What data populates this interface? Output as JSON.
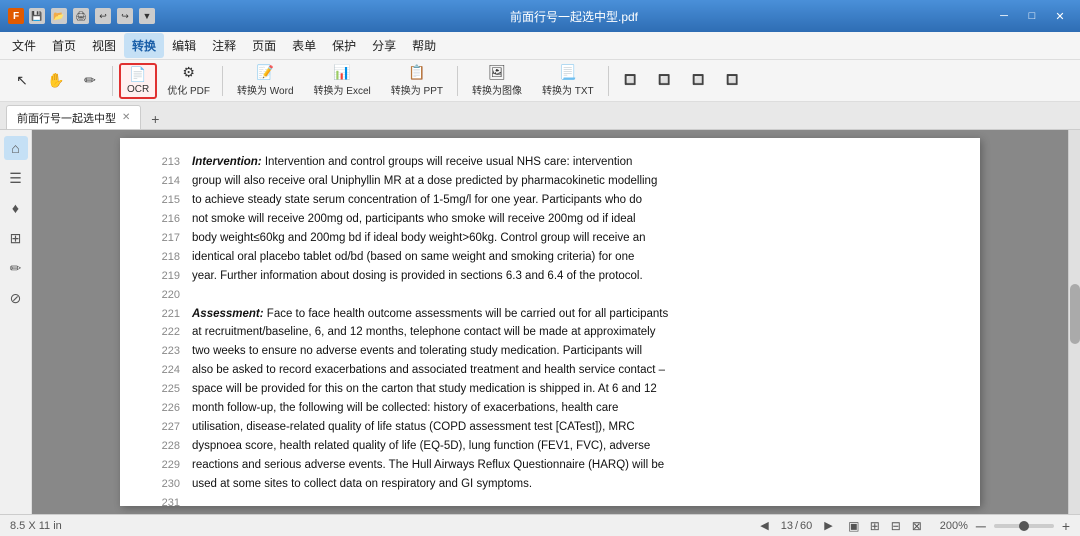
{
  "titlebar": {
    "title": "前面行号一起选中型.pdf",
    "app_icon": "F",
    "minimize": "─",
    "maximize": "□",
    "close": "✕"
  },
  "menubar": {
    "items": [
      {
        "label": "文件",
        "active": false
      },
      {
        "label": "首页",
        "active": false
      },
      {
        "label": "视图",
        "active": false
      },
      {
        "label": "转换",
        "active": true
      },
      {
        "label": "编辑",
        "active": false
      },
      {
        "label": "注释",
        "active": false
      },
      {
        "label": "页面",
        "active": false
      },
      {
        "label": "表单",
        "active": false
      },
      {
        "label": "保护",
        "active": false
      },
      {
        "label": "分享",
        "active": false
      },
      {
        "label": "帮助",
        "active": false
      }
    ]
  },
  "toolbar": {
    "ocr_label": "OCR",
    "optimize_label": "优化 PDF",
    "to_word_label": "转换为 Word",
    "to_excel_label": "转换为 Excel",
    "to_ppt_label": "转换为 PPT",
    "to_image_label": "转换为图像",
    "to_txt_label": "转换为 TXT"
  },
  "tabs": {
    "current_tab": "前面行号一起选中型",
    "add_label": "+"
  },
  "sidebar": {
    "icons": [
      "⌂",
      "☰",
      "♦",
      "⊞",
      "✏",
      "⊘"
    ]
  },
  "pdf": {
    "lines": [
      {
        "num": "213",
        "text": "<i><b>Intervention:</b></i> Intervention and control groups will receive usual NHS care: intervention"
      },
      {
        "num": "214",
        "text": "group will also receive oral Uniphyllin MR at a dose predicted by pharmacokinetic modelling"
      },
      {
        "num": "215",
        "text": "to achieve steady state serum concentration of 1-5mg/l for one year.  Participants who do"
      },
      {
        "num": "216",
        "text": "not smoke will receive 200mg od, participants who smoke will receive 200mg od if ideal"
      },
      {
        "num": "217",
        "text": "body weight≤60kg and 200mg bd if ideal body weight>60kg.  Control group will receive an"
      },
      {
        "num": "218",
        "text": "identical oral placebo tablet od/bd (based on same weight and smoking criteria) for one"
      },
      {
        "num": "219",
        "text": "year.  Further information about dosing is provided in sections 6.3 and 6.4 of the protocol."
      },
      {
        "num": "220",
        "text": ""
      },
      {
        "num": "221",
        "text": "<i><b>Assessment:</b></i> Face to face health outcome assessments will be carried out for all participants"
      },
      {
        "num": "222",
        "text": "at recruitment/baseline, 6, and 12 months, telephone contact will be made at approximately"
      },
      {
        "num": "223",
        "text": "two weeks to ensure no adverse events and tolerating study medication.  Participants will"
      },
      {
        "num": "224",
        "text": "also be asked to record exacerbations and associated treatment and health service contact –"
      },
      {
        "num": "225",
        "text": "space will be provided for this on the carton that study medication is shipped in.  At 6 and 12"
      },
      {
        "num": "226",
        "text": "month follow-up, the following will be collected: history of exacerbations, health care"
      },
      {
        "num": "227",
        "text": "utilisation, disease-related quality of life status (COPD assessment test [CATest]), MRC"
      },
      {
        "num": "228",
        "text": "dyspnoea score, health related quality of life (EQ-5D), lung function (FEV1, FVC), adverse"
      },
      {
        "num": "229",
        "text": "reactions and serious adverse events.  The Hull Airways Reflux Questionnaire (HARQ) will be"
      },
      {
        "num": "230",
        "text": "used at some sites to collect data on respiratory and GI symptoms."
      },
      {
        "num": "231",
        "text": ""
      }
    ]
  },
  "statusbar": {
    "size": "8.5 X 11 in",
    "page_current": "13",
    "page_total": "60",
    "zoom_level": "200%",
    "zoom_minus": "─",
    "zoom_plus": "+"
  }
}
